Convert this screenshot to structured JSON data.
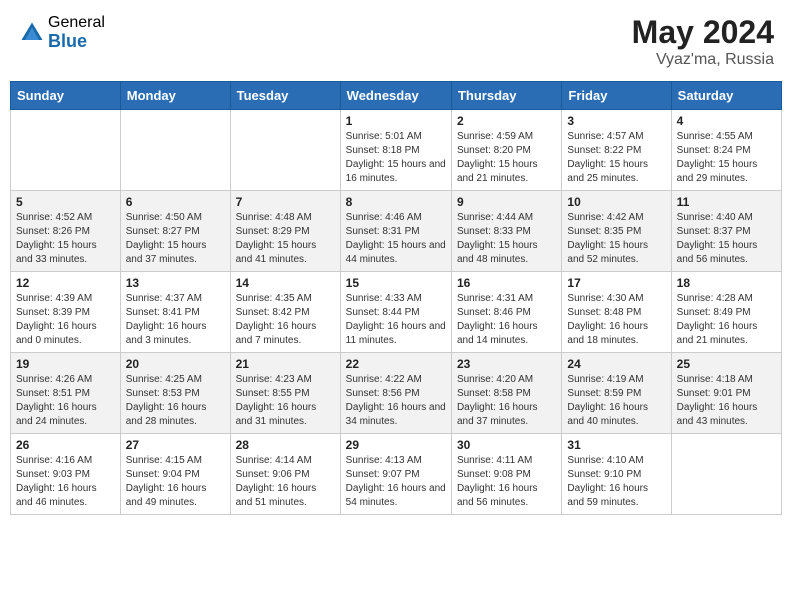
{
  "header": {
    "logo_general": "General",
    "logo_blue": "Blue",
    "month_year": "May 2024",
    "location": "Vyaz'ma, Russia"
  },
  "weekdays": [
    "Sunday",
    "Monday",
    "Tuesday",
    "Wednesday",
    "Thursday",
    "Friday",
    "Saturday"
  ],
  "weeks": [
    [
      null,
      null,
      null,
      {
        "day": 1,
        "sunrise": "5:01 AM",
        "sunset": "8:18 PM",
        "daylight": "15 hours and 16 minutes."
      },
      {
        "day": 2,
        "sunrise": "4:59 AM",
        "sunset": "8:20 PM",
        "daylight": "15 hours and 21 minutes."
      },
      {
        "day": 3,
        "sunrise": "4:57 AM",
        "sunset": "8:22 PM",
        "daylight": "15 hours and 25 minutes."
      },
      {
        "day": 4,
        "sunrise": "4:55 AM",
        "sunset": "8:24 PM",
        "daylight": "15 hours and 29 minutes."
      }
    ],
    [
      {
        "day": 5,
        "sunrise": "4:52 AM",
        "sunset": "8:26 PM",
        "daylight": "15 hours and 33 minutes."
      },
      {
        "day": 6,
        "sunrise": "4:50 AM",
        "sunset": "8:27 PM",
        "daylight": "15 hours and 37 minutes."
      },
      {
        "day": 7,
        "sunrise": "4:48 AM",
        "sunset": "8:29 PM",
        "daylight": "15 hours and 41 minutes."
      },
      {
        "day": 8,
        "sunrise": "4:46 AM",
        "sunset": "8:31 PM",
        "daylight": "15 hours and 44 minutes."
      },
      {
        "day": 9,
        "sunrise": "4:44 AM",
        "sunset": "8:33 PM",
        "daylight": "15 hours and 48 minutes."
      },
      {
        "day": 10,
        "sunrise": "4:42 AM",
        "sunset": "8:35 PM",
        "daylight": "15 hours and 52 minutes."
      },
      {
        "day": 11,
        "sunrise": "4:40 AM",
        "sunset": "8:37 PM",
        "daylight": "15 hours and 56 minutes."
      }
    ],
    [
      {
        "day": 12,
        "sunrise": "4:39 AM",
        "sunset": "8:39 PM",
        "daylight": "16 hours and 0 minutes."
      },
      {
        "day": 13,
        "sunrise": "4:37 AM",
        "sunset": "8:41 PM",
        "daylight": "16 hours and 3 minutes."
      },
      {
        "day": 14,
        "sunrise": "4:35 AM",
        "sunset": "8:42 PM",
        "daylight": "16 hours and 7 minutes."
      },
      {
        "day": 15,
        "sunrise": "4:33 AM",
        "sunset": "8:44 PM",
        "daylight": "16 hours and 11 minutes."
      },
      {
        "day": 16,
        "sunrise": "4:31 AM",
        "sunset": "8:46 PM",
        "daylight": "16 hours and 14 minutes."
      },
      {
        "day": 17,
        "sunrise": "4:30 AM",
        "sunset": "8:48 PM",
        "daylight": "16 hours and 18 minutes."
      },
      {
        "day": 18,
        "sunrise": "4:28 AM",
        "sunset": "8:49 PM",
        "daylight": "16 hours and 21 minutes."
      }
    ],
    [
      {
        "day": 19,
        "sunrise": "4:26 AM",
        "sunset": "8:51 PM",
        "daylight": "16 hours and 24 minutes."
      },
      {
        "day": 20,
        "sunrise": "4:25 AM",
        "sunset": "8:53 PM",
        "daylight": "16 hours and 28 minutes."
      },
      {
        "day": 21,
        "sunrise": "4:23 AM",
        "sunset": "8:55 PM",
        "daylight": "16 hours and 31 minutes."
      },
      {
        "day": 22,
        "sunrise": "4:22 AM",
        "sunset": "8:56 PM",
        "daylight": "16 hours and 34 minutes."
      },
      {
        "day": 23,
        "sunrise": "4:20 AM",
        "sunset": "8:58 PM",
        "daylight": "16 hours and 37 minutes."
      },
      {
        "day": 24,
        "sunrise": "4:19 AM",
        "sunset": "8:59 PM",
        "daylight": "16 hours and 40 minutes."
      },
      {
        "day": 25,
        "sunrise": "4:18 AM",
        "sunset": "9:01 PM",
        "daylight": "16 hours and 43 minutes."
      }
    ],
    [
      {
        "day": 26,
        "sunrise": "4:16 AM",
        "sunset": "9:03 PM",
        "daylight": "16 hours and 46 minutes."
      },
      {
        "day": 27,
        "sunrise": "4:15 AM",
        "sunset": "9:04 PM",
        "daylight": "16 hours and 49 minutes."
      },
      {
        "day": 28,
        "sunrise": "4:14 AM",
        "sunset": "9:06 PM",
        "daylight": "16 hours and 51 minutes."
      },
      {
        "day": 29,
        "sunrise": "4:13 AM",
        "sunset": "9:07 PM",
        "daylight": "16 hours and 54 minutes."
      },
      {
        "day": 30,
        "sunrise": "4:11 AM",
        "sunset": "9:08 PM",
        "daylight": "16 hours and 56 minutes."
      },
      {
        "day": 31,
        "sunrise": "4:10 AM",
        "sunset": "9:10 PM",
        "daylight": "16 hours and 59 minutes."
      },
      null
    ]
  ],
  "labels": {
    "sunrise": "Sunrise:",
    "sunset": "Sunset:",
    "daylight": "Daylight:"
  }
}
